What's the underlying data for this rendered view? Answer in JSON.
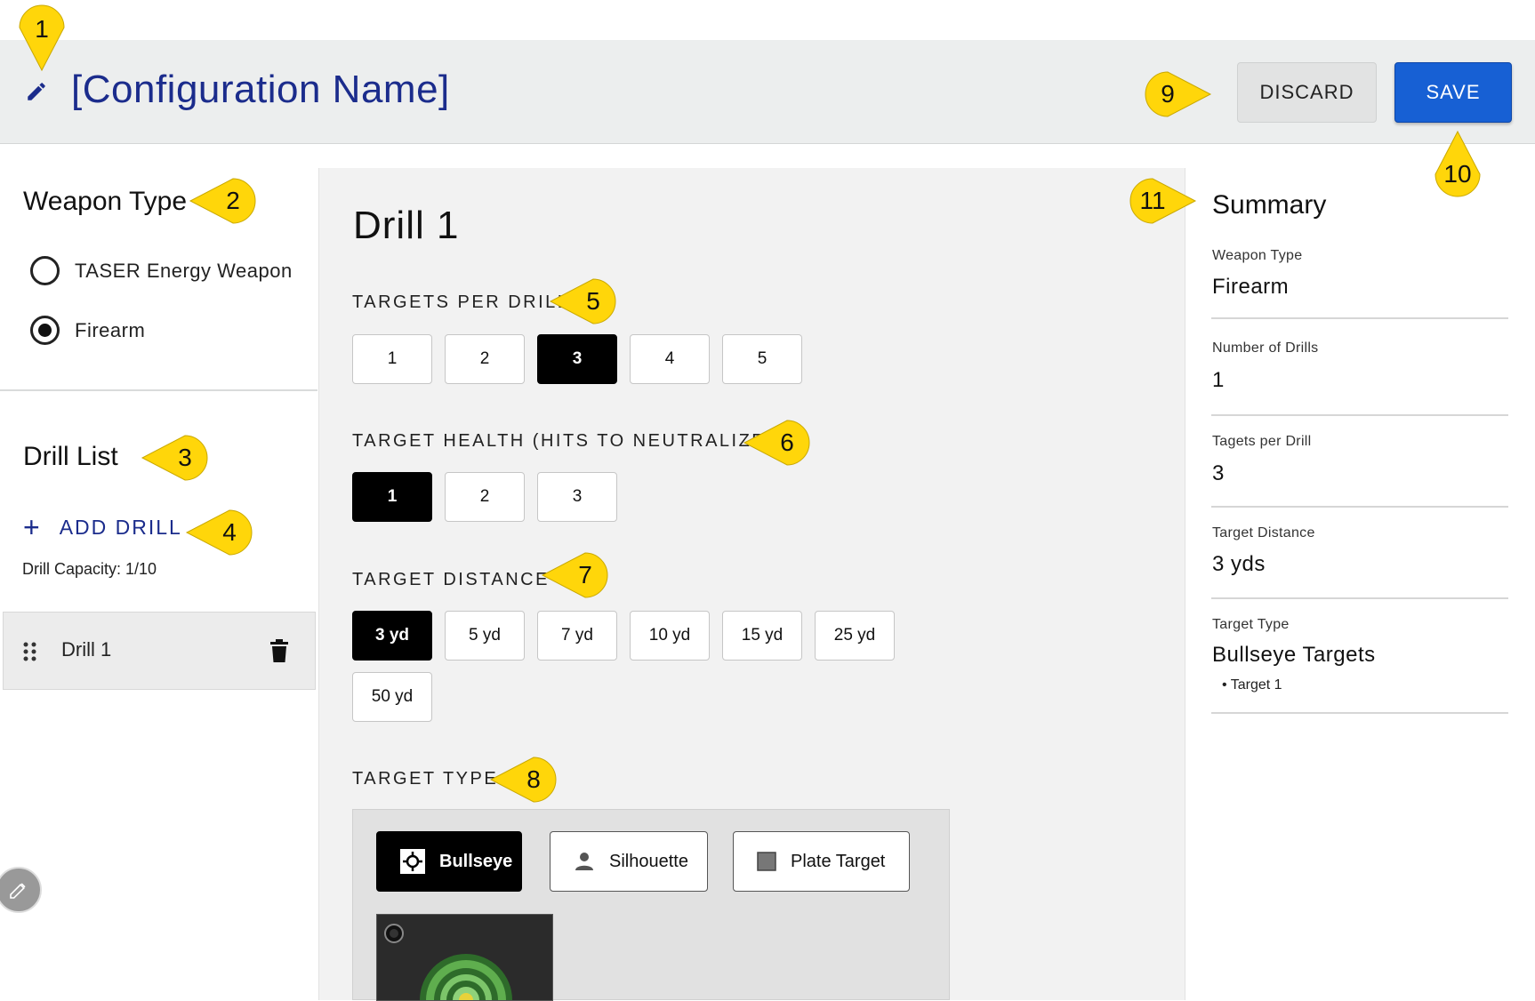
{
  "header": {
    "config_name": "[Configuration Name]",
    "discard_label": "DISCARD",
    "save_label": "SAVE"
  },
  "weapon_type": {
    "title": "Weapon Type",
    "options": [
      {
        "label": "TASER Energy Weapon",
        "selected": false
      },
      {
        "label": "Firearm",
        "selected": true
      }
    ]
  },
  "drill_list": {
    "title": "Drill List",
    "add_label": "ADD DRILL",
    "capacity": "Drill Capacity: 1/10",
    "items": [
      {
        "label": "Drill 1"
      }
    ]
  },
  "drill": {
    "title": "Drill 1",
    "targets_per_drill": {
      "label": "TARGETS PER DRILL",
      "options": [
        "1",
        "2",
        "3",
        "4",
        "5"
      ],
      "selected": "3"
    },
    "target_health": {
      "label": "TARGET HEALTH (HITS TO NEUTRALIZE)",
      "options": [
        "1",
        "2",
        "3"
      ],
      "selected": "1"
    },
    "target_distance": {
      "label": "TARGET DISTANCE",
      "options": [
        "3 yd",
        "5 yd",
        "7 yd",
        "10 yd",
        "15 yd",
        "25 yd",
        "50 yd"
      ],
      "selected": "3 yd"
    },
    "target_type": {
      "label": "TARGET TYPE",
      "options": [
        {
          "label": "Bullseye",
          "icon": "crosshair-icon",
          "selected": true
        },
        {
          "label": "Silhouette",
          "icon": "person-icon",
          "selected": false
        },
        {
          "label": "Plate Target",
          "icon": "square-icon",
          "selected": false
        }
      ]
    }
  },
  "summary": {
    "title": "Summary",
    "rows": [
      {
        "label": "Weapon Type",
        "value": "Firearm"
      },
      {
        "label": "Number of Drills",
        "value": "1"
      },
      {
        "label": "Tagets per Drill",
        "value": "3"
      },
      {
        "label": "Target Distance",
        "value": "3 yds"
      },
      {
        "label": "Target Type",
        "value": "Bullseye Targets"
      }
    ],
    "target_item": "• Target 1"
  },
  "callouts": [
    "1",
    "2",
    "3",
    "4",
    "5",
    "6",
    "7",
    "8",
    "9",
    "10",
    "11"
  ],
  "colors": {
    "accent": "#1b2c8c",
    "save_button": "#1760d4",
    "callout": "#ffd60a",
    "selected": "#000000"
  }
}
